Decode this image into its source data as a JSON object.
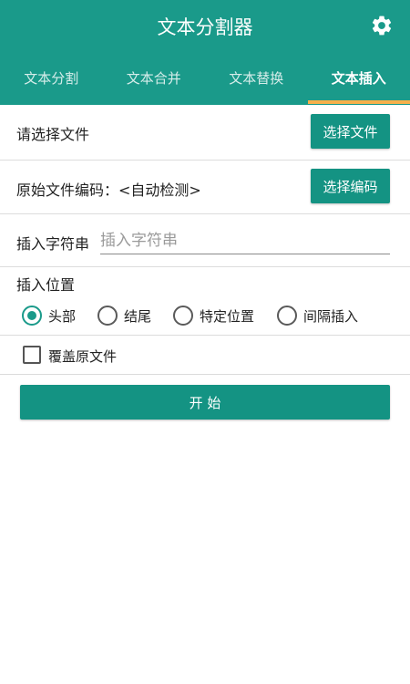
{
  "header": {
    "title": "文本分割器",
    "settings_icon": "gear-icon",
    "accent_color": "#1a9a8a",
    "indicator_color": "#f5b04c"
  },
  "tabs": [
    {
      "label": "文本分割",
      "active": false
    },
    {
      "label": "文本合并",
      "active": false
    },
    {
      "label": "文本替换",
      "active": false
    },
    {
      "label": "文本插入",
      "active": true
    }
  ],
  "file_row": {
    "label": "请选择文件",
    "button": "选择文件"
  },
  "encoding_row": {
    "label": "原始文件编码：<自动检测>",
    "button": "选择编码"
  },
  "insert_string": {
    "label": "插入字符串",
    "value": "",
    "placeholder": "插入字符串"
  },
  "position": {
    "label": "插入位置",
    "options": [
      {
        "label": "头部",
        "checked": true
      },
      {
        "label": "结尾",
        "checked": false
      },
      {
        "label": "特定位置",
        "checked": false
      },
      {
        "label": "间隔插入",
        "checked": false
      }
    ]
  },
  "overwrite": {
    "label": "覆盖原文件",
    "checked": false
  },
  "start_button": "开 始"
}
